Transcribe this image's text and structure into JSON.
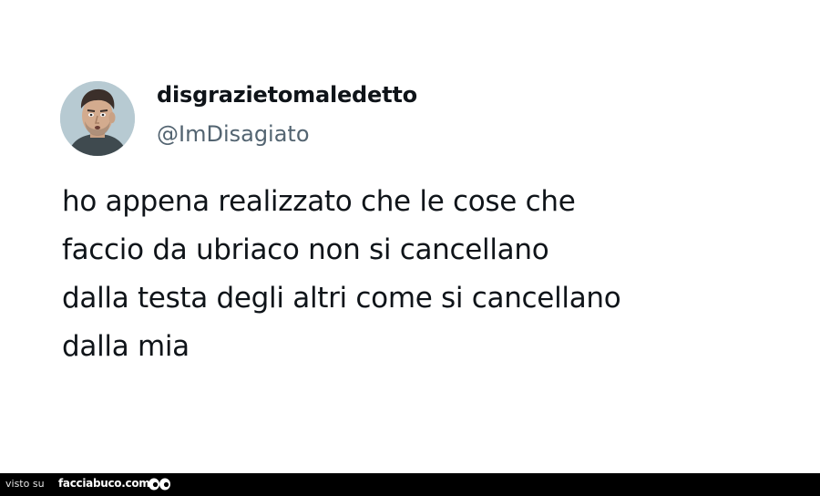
{
  "tweet": {
    "display_name": "disgrazietomaledetto",
    "handle": "@ImDisagiato",
    "text": "ho appena realizzato che le cose che\nfaccio da ubriaco non si cancellano\ndalla testa degli altri come si cancellano\ndalla mia",
    "avatar_icon": "cartoon-face-avatar"
  },
  "footer": {
    "prefix": "visto su",
    "site": "facciabuco.com",
    "logo_icon": "eyes-logo-icon"
  },
  "colors": {
    "background": "#ffffff",
    "text_primary": "#0f1419",
    "text_secondary": "#536471",
    "footer_background": "#000000"
  }
}
